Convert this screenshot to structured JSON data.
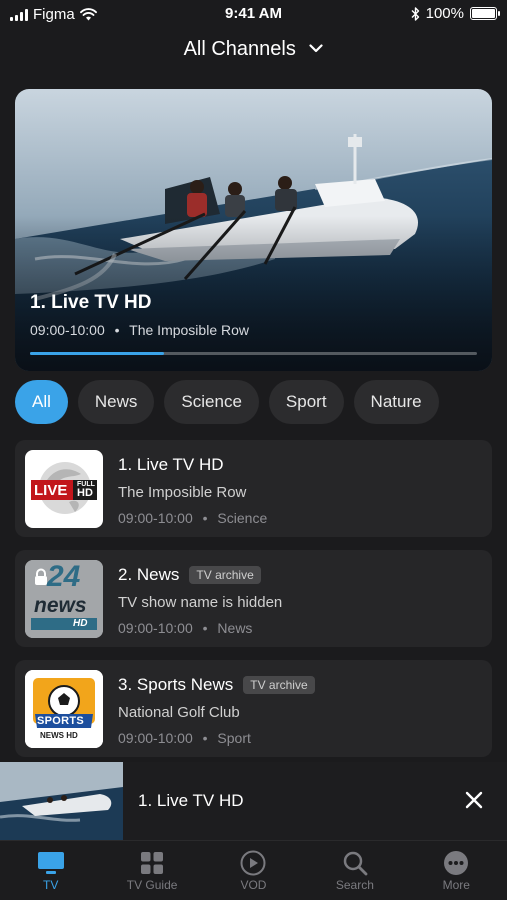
{
  "status_bar": {
    "carrier": "Figma",
    "time": "9:41 AM",
    "battery": "100%"
  },
  "header": {
    "title": "All Channels",
    "icon": "chevron-down-icon"
  },
  "hero": {
    "title": "1. Live TV HD",
    "time": "09:00-10:00",
    "program": "The Imposible Row",
    "separator": "•",
    "progress": 0.3,
    "accent": "#3aa3e8"
  },
  "filters": {
    "items": [
      "All",
      "News",
      "Science",
      "Sport",
      "Nature"
    ],
    "selected": "All"
  },
  "channels": [
    {
      "title": "1. Live TV HD",
      "badge": "",
      "program": "The Imposible Row",
      "time": "09:00-10:00",
      "category": "Science",
      "separator": "•",
      "logo": {
        "main": "LIVE",
        "tag_top": "FULL",
        "tag_bottom": "HD"
      }
    },
    {
      "title": "2. News",
      "badge": "TV archive",
      "program": "TV show name is hidden",
      "time": "09:00-10:00",
      "category": "News",
      "separator": "•",
      "logo": {
        "main": "news",
        "number": "24",
        "sub": "HD",
        "lock": "lock-icon"
      }
    },
    {
      "title": "3. Sports News",
      "badge": "TV archive",
      "program": "National Golf Club",
      "time": "09:00-10:00",
      "category": "Sport",
      "separator": "•",
      "logo": {
        "main": "SPORTS",
        "sub": "NEWS HD"
      }
    }
  ],
  "mini_player": {
    "title": "1. Live TV HD",
    "close_icon": "close-icon"
  },
  "tab_bar": {
    "items": [
      {
        "label": "TV",
        "icon": "tv-icon",
        "active": true
      },
      {
        "label": "TV Guide",
        "icon": "grid-icon",
        "active": false
      },
      {
        "label": "VOD",
        "icon": "play-circle-icon",
        "active": false
      },
      {
        "label": "Search",
        "icon": "search-icon",
        "active": false
      },
      {
        "label": "More",
        "icon": "more-icon",
        "active": false
      }
    ]
  }
}
